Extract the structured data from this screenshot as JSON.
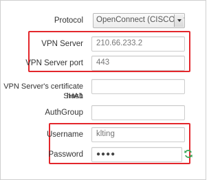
{
  "form": {
    "protocol": {
      "label": "Protocol",
      "value": "OpenConnect (CISCO AnyConnect)"
    },
    "vpn_server": {
      "label": "VPN Server",
      "value": "210.66.233.2"
    },
    "vpn_server_port": {
      "label": "VPN Server port",
      "value": "443"
    },
    "cert_hash": {
      "label_line1": "VPN Server's certificate SHA1",
      "label_line2": "hash",
      "value": ""
    },
    "auth_group": {
      "label": "AuthGroup",
      "value": ""
    },
    "username": {
      "label": "Username",
      "value": "klting"
    },
    "password": {
      "label": "Password",
      "value": "●●●●"
    }
  },
  "colors": {
    "highlight": "#e3262b",
    "refresh_icon": "#3aa757"
  },
  "icons": {
    "protocol_dropdown": "chevron-down-icon",
    "password_reveal": "refresh-icon"
  }
}
